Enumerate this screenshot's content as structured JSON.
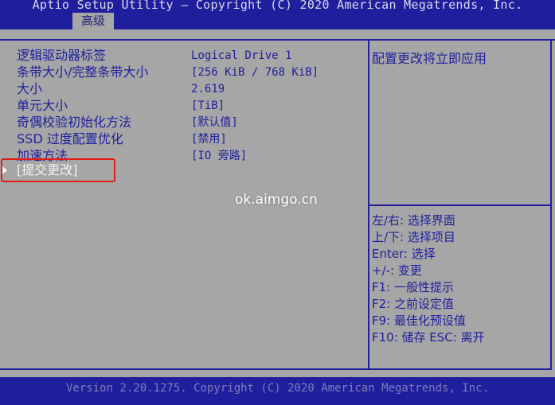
{
  "header": {
    "title": "Aptio Setup Utility – Copyright (C) 2020 American Megatrends, Inc.",
    "tab": "高级"
  },
  "settings": [
    {
      "label": "逻辑驱动器标签",
      "value": "Logical Drive 1"
    },
    {
      "label": "条带大小/完整条带大小",
      "value": "[256 KiB / 768 KiB]"
    },
    {
      "label": "大小",
      "value": "2.619"
    },
    {
      "label": "单元大小",
      "value": "[TiB]"
    },
    {
      "label": "奇偶校验初始化方法",
      "value": "[默认值]"
    },
    {
      "label": "SSD 过度配置优化",
      "value": "[禁用]"
    },
    {
      "label": "加速方法",
      "value": "[IO 旁路]"
    }
  ],
  "submit_item": "[提交更改]",
  "help": {
    "description": "配置更改将立即应用",
    "keys": [
      "左/右: 选择界面",
      "上/下: 选择项目",
      "Enter: 选择",
      "+/-: 变更",
      "F1: 一般性提示",
      "F2: 之前设定值",
      "F9: 最佳化预设值",
      "F10: 储存  ESC: 离开"
    ]
  },
  "watermark": "ok.aimgo.cn",
  "footer": "Version 2.20.1275. Copyright (C) 2020 American Megatrends, Inc.",
  "colors": {
    "bar": "#1f1f9e",
    "background": "#a6a6a6",
    "highlight_box": "#e21a1a"
  }
}
